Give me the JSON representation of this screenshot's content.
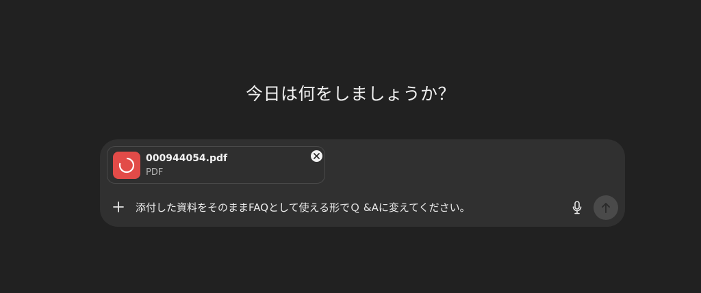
{
  "heading": "今日は何をしましょうか？",
  "composer": {
    "attachment": {
      "file_name": "000944054.pdf",
      "file_type": "PDF",
      "icon": "pdf-loading-ring-icon",
      "icon_color": "#e24b48",
      "remove_icon": "close-circle-icon"
    },
    "add_icon": "plus-icon",
    "prompt_text": "添付した資料をそのままFAQとして使える形でＱ &Aに変えてください。",
    "mic_icon": "microphone-icon",
    "send_icon": "arrow-up-icon",
    "send_disabled": true
  },
  "colors": {
    "background": "#212121",
    "composer_bg": "#303030",
    "accent_file": "#e24b48"
  }
}
